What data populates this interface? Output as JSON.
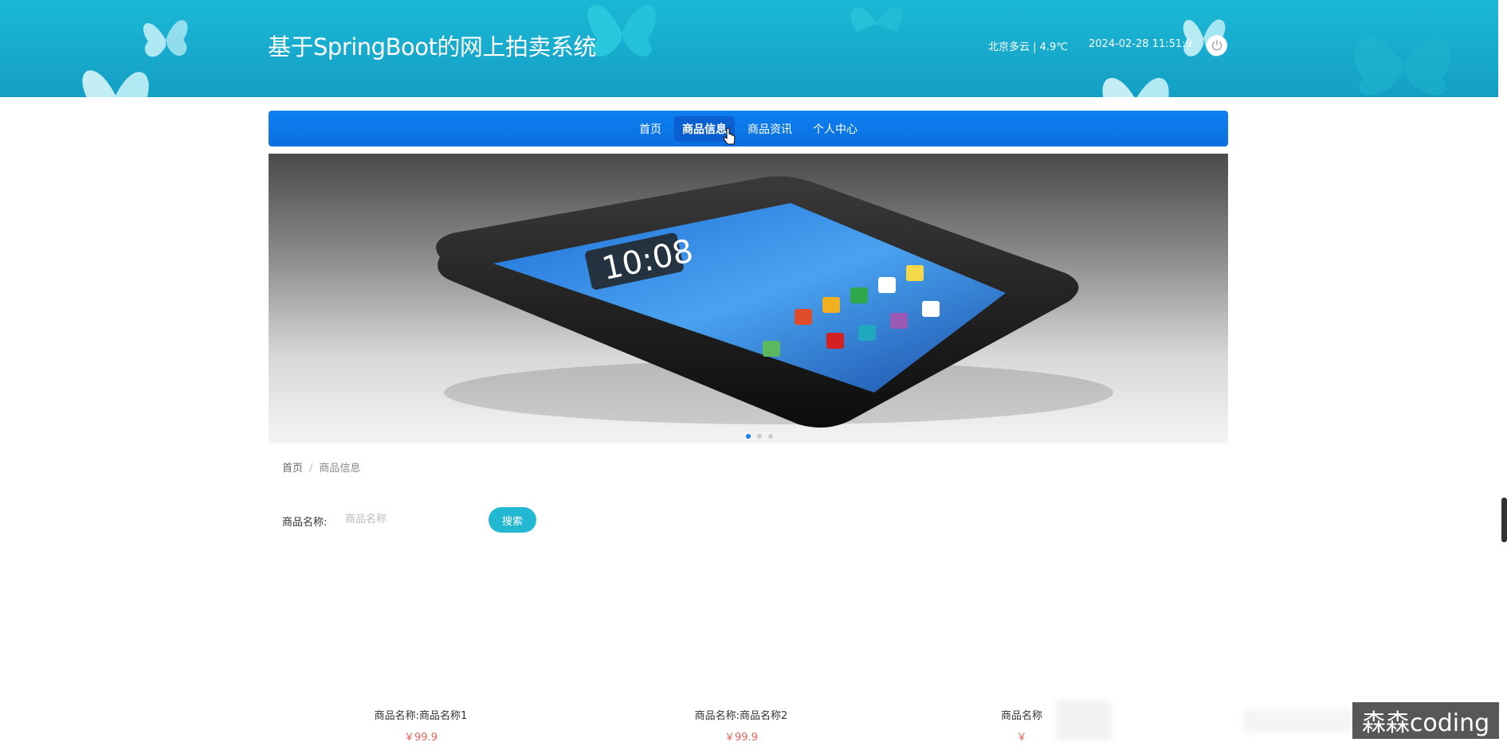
{
  "header": {
    "title": "基于SpringBoot的网上拍卖系统",
    "weather": "北京多云 | 4.9℃",
    "datetime": "2024-02-28   11:51:9"
  },
  "nav": {
    "items": [
      {
        "label": "首页"
      },
      {
        "label": "商品信息"
      },
      {
        "label": "商品资讯"
      },
      {
        "label": "个人中心"
      }
    ],
    "active_index": 1
  },
  "banner": {
    "slides": 3,
    "active_slide": 1,
    "screen_clock": "10:08"
  },
  "breadcrumb": {
    "home": "首页",
    "separator": "/",
    "current": "商品信息"
  },
  "search": {
    "label": "商品名称:",
    "placeholder": "商品名称",
    "button": "搜索"
  },
  "products": [
    {
      "name": "商品名称:商品名称1",
      "price": "￥99.9"
    },
    {
      "name": "商品名称:商品名称2",
      "price": "￥99.9"
    },
    {
      "name": "商品名称",
      "price": "￥"
    }
  ],
  "watermark": "森森coding",
  "colors": {
    "header": "#17a9cc",
    "nav": "#0a6fe0",
    "search_button": "#22b8d2",
    "price": "#e0645a"
  }
}
